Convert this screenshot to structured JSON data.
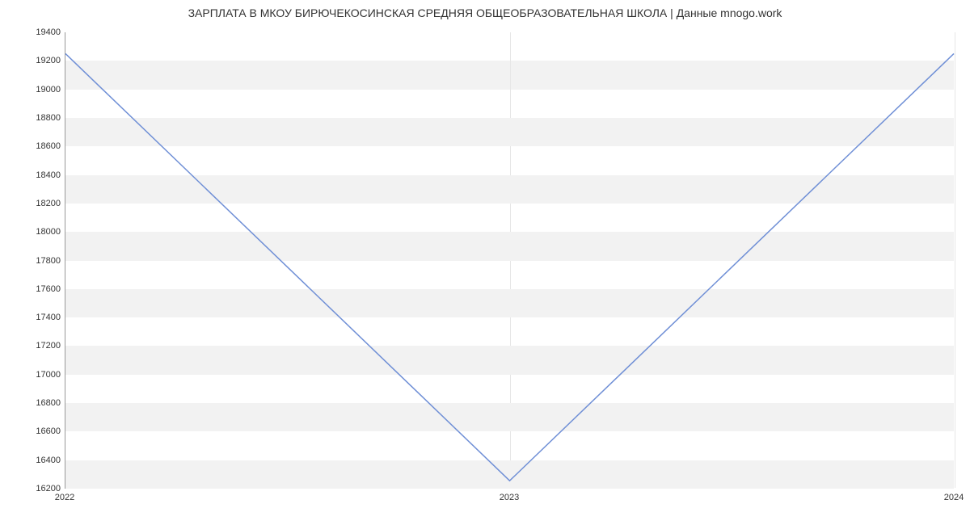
{
  "chart_data": {
    "type": "line",
    "title": "ЗАРПЛАТА В МКОУ БИРЮЧЕКОСИНСКАЯ СРЕДНЯЯ ОБЩЕОБРАЗОВАТЕЛЬНАЯ ШКОЛА | Данные mnogo.work",
    "xlabel": "",
    "ylabel": "",
    "x": [
      "2022",
      "2023",
      "2024"
    ],
    "values": [
      19250,
      16250,
      19250
    ],
    "ylim": [
      16200,
      19400
    ],
    "yticks": [
      16200,
      16400,
      16600,
      16800,
      17000,
      17200,
      17400,
      17600,
      17800,
      18000,
      18200,
      18400,
      18600,
      18800,
      19000,
      19200,
      19400
    ],
    "xticks": [
      "2022",
      "2023",
      "2024"
    ],
    "line_color": "#6f8fd6"
  }
}
